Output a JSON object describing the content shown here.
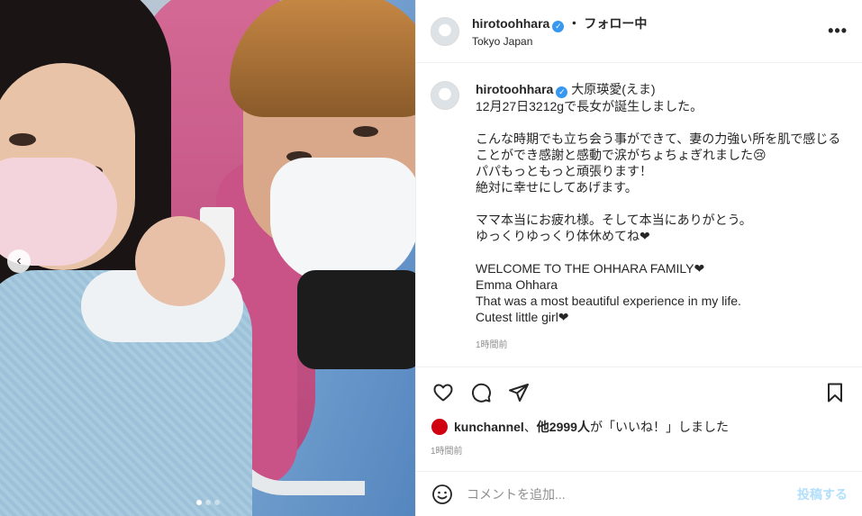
{
  "header": {
    "username": "hirotoohhara",
    "separator": "・",
    "follow_status": "フォロー中",
    "location": "Tokyo Japan",
    "more_icon": "more-horizontal-icon"
  },
  "caption": {
    "username": "hirotoohhara",
    "tag": "大原瑛愛(えま)",
    "lines": [
      "12月27日3212gで長女が誕生しました。",
      "",
      "こんな時期でも立ち会う事ができて、妻の力強い所を肌で感じる",
      "ことができ感謝と感動で涙がちょちょぎれました😢",
      "パパもっともっと頑張ります！",
      "絶対に幸せにしてあげます。",
      "",
      "ママ本当にお疲れ様。そして本当にありがとう。",
      "ゆっくりゆっくり体休めてね❤",
      "",
      "WELCOME TO THE OHHARA FAMILY❤",
      "Emma Ohhara",
      "That was a most beautiful experience in my life.",
      "Cutest little girl❤"
    ],
    "time": "1時間前"
  },
  "actions": {
    "like_icon": "heart-icon",
    "comment_icon": "comment-icon",
    "share_icon": "share-icon",
    "save_icon": "bookmark-icon"
  },
  "likes": {
    "first_user": "kunchannel",
    "joiner": "、",
    "others": "他2999人",
    "suffix_pre": "が",
    "suffix": "「いいね！」しました"
  },
  "posted_ago": "1時間前",
  "comment_box": {
    "placeholder": "コメントを追加...",
    "post_label": "投稿する",
    "emoji_icon": "smiley-icon"
  },
  "carousel": {
    "prev_icon": "chevron-left-icon",
    "dot_count": 3,
    "active_dot": 0
  },
  "colors": {
    "verified": "#3897f0",
    "post_button_disabled": "#b2dffc",
    "muted_text": "#8e8e8e"
  }
}
